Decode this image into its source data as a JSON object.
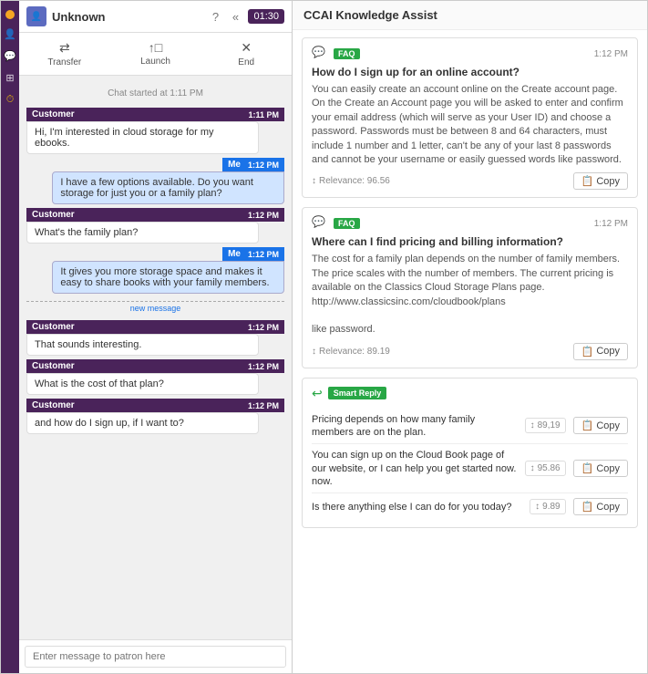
{
  "sidebar": {
    "items": [
      {
        "name": "dot",
        "label": "status dot"
      },
      {
        "name": "person-icon",
        "label": "👤"
      },
      {
        "name": "chat-icon",
        "label": "💬"
      },
      {
        "name": "home-icon",
        "label": "⊞"
      },
      {
        "name": "timer-icon",
        "label": "⏱"
      }
    ]
  },
  "chat": {
    "header": {
      "name": "Unknown",
      "timer": "01:30",
      "help_icon": "?",
      "collapse_icon": "«"
    },
    "toolbar": {
      "transfer_label": "Transfer",
      "launch_label": "Launch",
      "end_label": "End"
    },
    "messages": [
      {
        "type": "system",
        "text": "Chat started at 1:11 PM"
      },
      {
        "type": "customer",
        "sender": "Customer",
        "time": "1:11 PM",
        "text": "Hi, I'm interested in cloud storage for my ebooks."
      },
      {
        "type": "me",
        "sender": "Me",
        "time": "1:12 PM",
        "text": "I have a few  options available. Do you want storage for just you or a family plan?"
      },
      {
        "type": "customer",
        "sender": "Customer",
        "time": "1:12 PM",
        "text": "What's the family plan?"
      },
      {
        "type": "me",
        "sender": "Me",
        "time": "1:12 PM",
        "text": "It gives you more storage space and makes it easy to share books with your family members."
      },
      {
        "type": "new_message",
        "text": "new message"
      },
      {
        "type": "customer",
        "sender": "Customer",
        "time": "1:12 PM",
        "text": "That sounds interesting."
      },
      {
        "type": "customer",
        "sender": "Customer",
        "time": "1:12 PM",
        "text": "What is the cost of that plan?"
      },
      {
        "type": "customer",
        "sender": "Customer",
        "time": "1:12 PM",
        "text": "and how do I sign up, if I want to?"
      }
    ],
    "input_placeholder": "Enter message to patron here"
  },
  "knowledge": {
    "header": "CCAI Knowledge Assist",
    "faqs": [
      {
        "badge": "FAQ",
        "time": "1:12 PM",
        "question": "How do I sign up for an online account?",
        "answer": "You can easily create an account online on the Create account page. On the Create an Account page you will be asked to enter and confirm your email address (which will serve as your User ID) and choose a password. Passwords must be between 8 and 64 characters, must include 1 number and 1 letter, can't be any of your last 8 passwords and cannot be your username or easily guessed words like password.",
        "relevance": "Relevance: 96.56",
        "copy_label": "Copy"
      },
      {
        "badge": "FAQ",
        "time": "1:12 PM",
        "question": "Where can I find pricing and billing information?",
        "answer": "The cost for a family plan depends on the number of family members. The price scales with the number of members. The current pricing is available on the Classics Cloud Storage Plans page.\nhttp://www.classicsinc.com/cloudbook/plans\n\nlike password.",
        "relevance": "Relevance: 89.19",
        "copy_label": "Copy"
      }
    ],
    "smart_reply": {
      "header_label": "Smart Reply",
      "items": [
        {
          "text": "Pricing depends on how many family members are on the plan.",
          "score": "89,19",
          "copy_label": "Copy"
        },
        {
          "text": "You can sign up on the Cloud Book page of our website, or I can help you get started now. now.",
          "score": "95.86",
          "copy_label": "Copy"
        },
        {
          "text": "Is there anything else I can do for you today?",
          "score": "9.89",
          "copy_label": "Copy"
        }
      ]
    }
  }
}
